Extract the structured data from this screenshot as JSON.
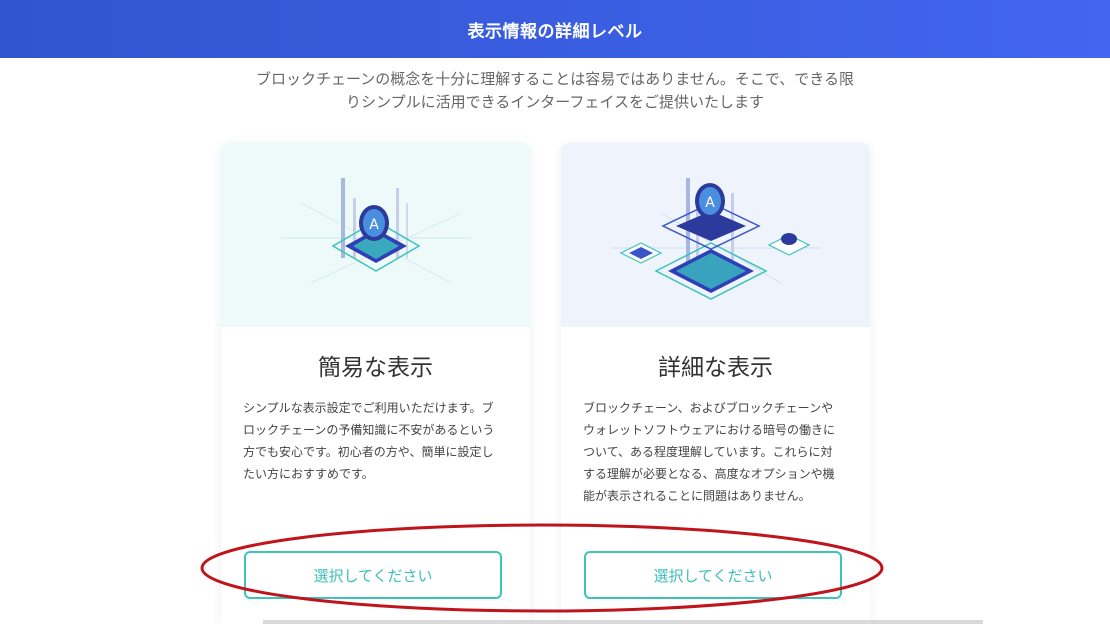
{
  "header": {
    "title": "表示情報の詳細レベル"
  },
  "intro": {
    "line1": "ブロックチェーンの概念を十分に理解することは容易ではありません。そこで、できる限",
    "line2": "りシンプルに活用できるインターフェイスをご提供いたします"
  },
  "cards": [
    {
      "title": "簡易な表示",
      "description": [
        "シンプルな表示設定でご利用いただけます。ブ",
        "ロックチェーンの予備知識に不安があるという",
        "方でも安心です。初心者の方や、簡単に設定し",
        "たい方におすすめです。"
      ],
      "button_label": "選択してください",
      "illustration_icon": "blockchain-chip-icon"
    },
    {
      "title": "詳細な表示",
      "description": [
        "ブロックチェーン、およびブロックチェーンや",
        "ウォレットソフトウェアにおける暗号の働きに",
        "ついて、ある程度理解しています。これらに対",
        "する理解が必要となる、高度なオプションや機",
        "能が表示されることに問題はありません。"
      ],
      "button_label": "選択してください",
      "illustration_icon": "blockchain-network-icon"
    }
  ],
  "colors": {
    "header_start": "#3154d0",
    "header_end": "#4365f0",
    "button_border": "#3dc3b8",
    "annotation_red": "#c0141c"
  }
}
